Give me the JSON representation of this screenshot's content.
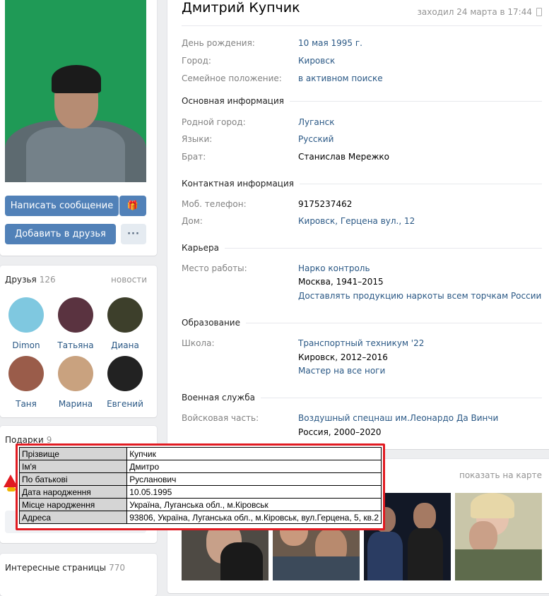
{
  "profile": {
    "name": "Дмитрий Купчик",
    "last_seen": "заходил 24 марта в 17:44",
    "buttons": {
      "write": "Написать сообщение",
      "gift": "🎁",
      "add_friend": "Добавить в друзья",
      "more": "···"
    }
  },
  "info": {
    "birthday": {
      "label": "День рождения:",
      "value": "10 мая 1995 г."
    },
    "city": {
      "label": "Город:",
      "value": "Кировск"
    },
    "family": {
      "label": "Семейное положение:",
      "value": "в активном поиске"
    },
    "basic": {
      "title": "Основная информация",
      "hometown": {
        "label": "Родной город:",
        "value": "Луганск"
      },
      "languages": {
        "label": "Языки:",
        "value": "Русский"
      },
      "brother": {
        "label": "Брат:",
        "value": "Станислав Мережко"
      }
    },
    "contacts": {
      "title": "Контактная информация",
      "mobile": {
        "label": "Моб. телефон:",
        "value": "9175237462"
      },
      "home": {
        "label": "Дом:",
        "value": "Кировск, Герцена вул., 12"
      }
    },
    "career": {
      "title": "Карьера",
      "work": {
        "label": "Место работы:",
        "org": "Нарко контроль",
        "years": "Москва, 1941–2015",
        "position": "Доставлять продукцию наркоты всем торчкам России"
      }
    },
    "education": {
      "title": "Образование",
      "school": {
        "label": "Школа:",
        "name": "Транспортный техникум '22",
        "years": "Кировск, 2012–2016",
        "spec": "Мастер на все ноги"
      }
    },
    "military": {
      "title": "Военная служба",
      "unit": {
        "label": "Войсковая часть:",
        "name": "Воздушный спецнаш им.Леонардо Да Винчи",
        "years": "Россия, 2000–2020"
      }
    }
  },
  "friends": {
    "title": "Друзья",
    "count": "126",
    "news_link": "новости",
    "items": [
      {
        "name": "Dimon",
        "color": "#7fc8e0"
      },
      {
        "name": "Татьяна",
        "color": "#5a3340"
      },
      {
        "name": "Диана",
        "color": "#3d3f2b"
      },
      {
        "name": "Таня",
        "color": "#9a5c4a"
      },
      {
        "name": "Марина",
        "color": "#c9a27f"
      },
      {
        "name": "Евгений",
        "color": "#222222"
      }
    ]
  },
  "gifts": {
    "title": "Подарки",
    "count": "9"
  },
  "pages": {
    "title": "Интересные страницы",
    "count": "770"
  },
  "photos": {
    "map_link": "показать на карте"
  },
  "overlay_table": {
    "rows": [
      {
        "key": "Прізвище",
        "value": "Купчик"
      },
      {
        "key": "Ім'я",
        "value": "Дмитро"
      },
      {
        "key": "По батькові",
        "value": "Русланович"
      },
      {
        "key": "Дата народження",
        "value": "10.05.1995"
      },
      {
        "key": "Місце народження",
        "value": "Україна, Луганська обл., м.Кіровськ"
      },
      {
        "key": "Адреса",
        "value": "93806, Україна, Луганська обл., м.Кіровськ, вул.Герцена, 5, кв.2"
      }
    ]
  },
  "colors": {
    "link": "#2a5885",
    "button": "#5181b8",
    "overlay_border": "#e11b22"
  }
}
